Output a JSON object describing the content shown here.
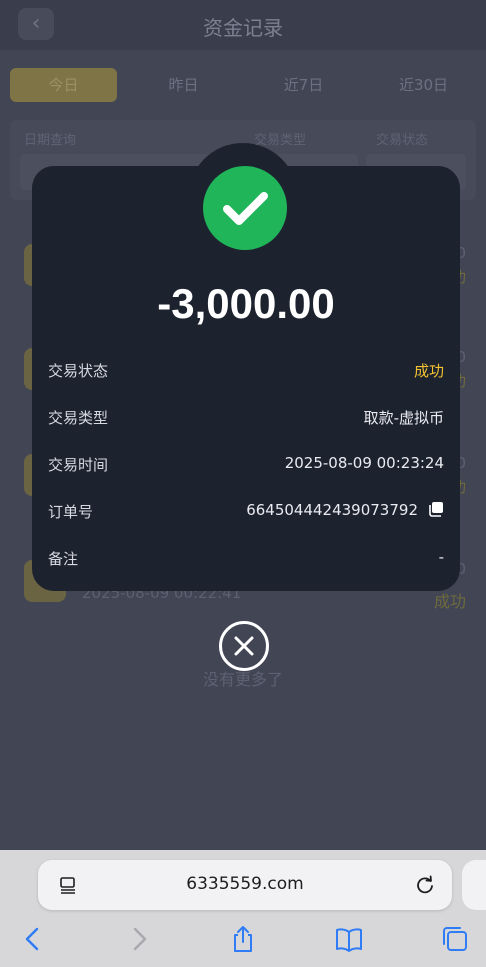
{
  "page": {
    "title": "资金记录",
    "back_icon": "chevron-left-icon",
    "tabs": [
      {
        "label": "今日",
        "active": true
      },
      {
        "label": "昨日",
        "active": false
      },
      {
        "label": "近7日",
        "active": false
      },
      {
        "label": "近30日",
        "active": false
      }
    ],
    "filter": {
      "date_label": "日期查询",
      "type_label": "交易类型",
      "status_label": "交易状态"
    },
    "records": [
      {
        "amount": "0",
        "status": "功",
        "time": ""
      },
      {
        "amount": "0",
        "status": "功",
        "time": ""
      },
      {
        "amount": "0",
        "status": "功",
        "time": ""
      },
      {
        "amount": "0",
        "status": "成功",
        "time": "2025-08-09 00:22:41"
      }
    ],
    "no_more": "没有更多了"
  },
  "modal": {
    "icon": "check-circle-icon",
    "amount": "-3,000.00",
    "rows": [
      {
        "label": "交易状态",
        "value": "成功"
      },
      {
        "label": "交易类型",
        "value": "取款-虚拟币"
      },
      {
        "label": "交易时间",
        "value": "2025-08-09 00:23:24"
      },
      {
        "label": "订单号",
        "value": "664504442439073792"
      },
      {
        "label": "备注",
        "value": "-"
      }
    ],
    "close_icon": "close-circle-icon"
  },
  "browser": {
    "url": "6335559.com",
    "colors": {
      "success": "#f2c230",
      "check_green": "#20b559",
      "modal_bg": "#1d222f",
      "ios_blue": "#2f7cf6"
    }
  }
}
